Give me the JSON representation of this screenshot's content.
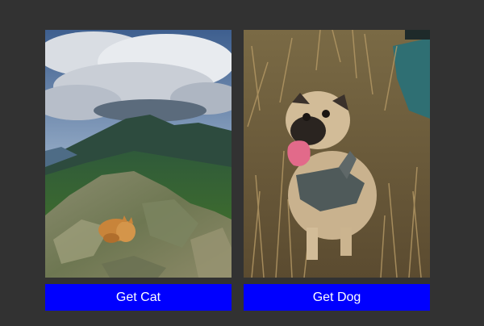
{
  "colors": {
    "page_background": "#323232",
    "button_background": "#0000ff",
    "button_text": "#ffffff"
  },
  "cards": [
    {
      "image_icon": "cat-on-mountain-photo",
      "button_label": "Get Cat"
    },
    {
      "image_icon": "pug-in-grass-photo",
      "button_label": "Get Dog"
    }
  ]
}
